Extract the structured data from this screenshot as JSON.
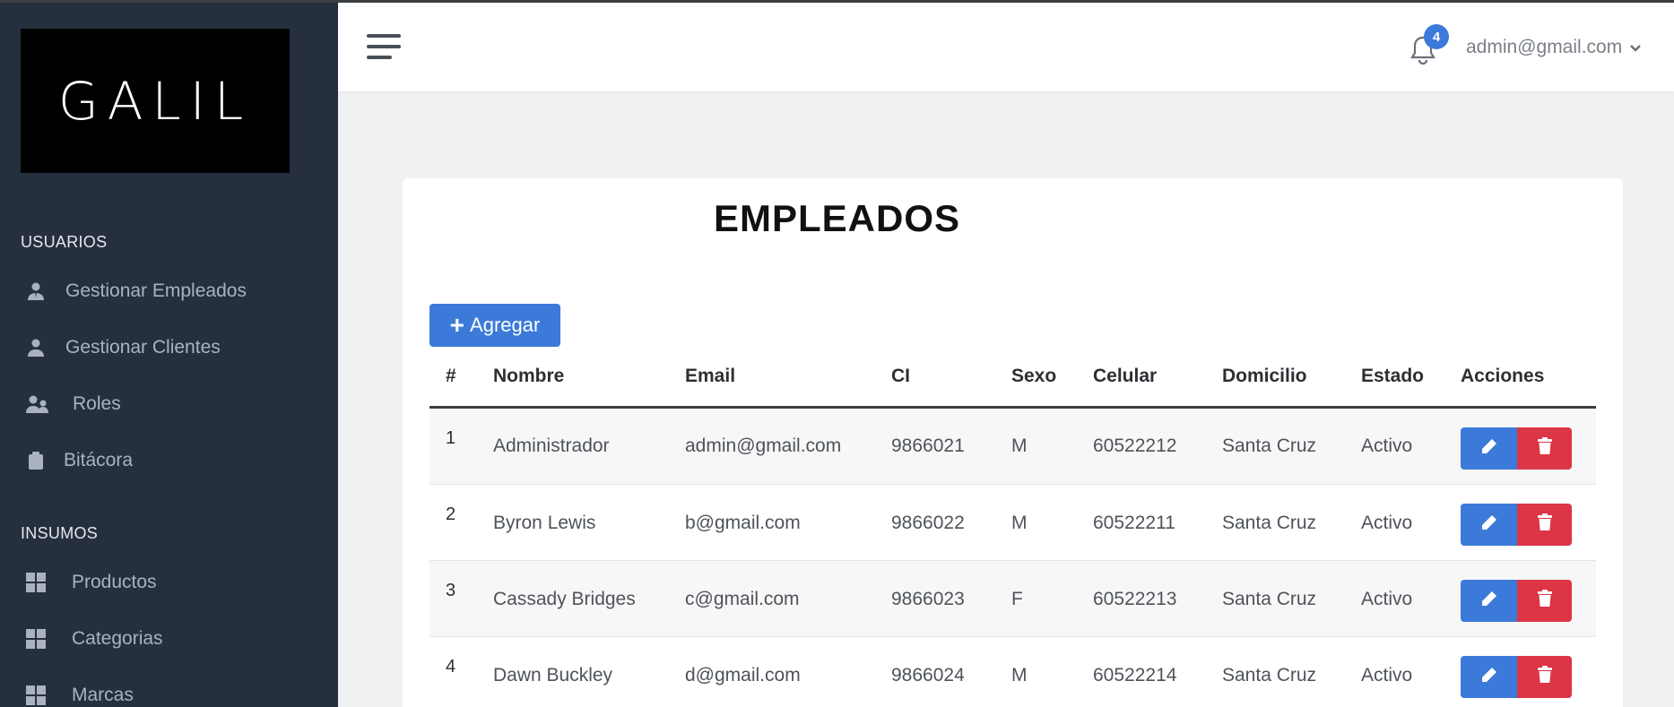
{
  "logo": {
    "text": "GALIL"
  },
  "sidebar": {
    "sections": [
      {
        "heading": "USUARIOS",
        "items": [
          {
            "label": "Gestionar Empleados",
            "icon": "user-tie-icon"
          },
          {
            "label": "Gestionar Clientes",
            "icon": "user-icon"
          },
          {
            "label": "Roles",
            "icon": "users-cog-icon"
          },
          {
            "label": "Bitácora",
            "icon": "clipboard-icon"
          }
        ]
      },
      {
        "heading": "INSUMOS",
        "items": [
          {
            "label": "Productos",
            "icon": "grid-icon"
          },
          {
            "label": "Categorias",
            "icon": "grid-icon"
          },
          {
            "label": "Marcas",
            "icon": "grid-icon"
          }
        ]
      }
    ]
  },
  "topbar": {
    "notification_count": "4",
    "user_email": "admin@gmail.com"
  },
  "page": {
    "title": "EMPLEADOS",
    "add_label": "Agregar"
  },
  "table": {
    "columns": [
      "#",
      "Nombre",
      "Email",
      "CI",
      "Sexo",
      "Celular",
      "Domicilio",
      "Estado",
      "Acciones"
    ],
    "rows": [
      [
        "1",
        "Administrador",
        "admin@gmail.com",
        "9866021",
        "M",
        "60522212",
        "Santa Cruz",
        "Activo"
      ],
      [
        "2",
        "Byron Lewis",
        "b@gmail.com",
        "9866022",
        "M",
        "60522211",
        "Santa Cruz",
        "Activo"
      ],
      [
        "3",
        "Cassady Bridges",
        "c@gmail.com",
        "9866023",
        "F",
        "60522213",
        "Santa Cruz",
        "Activo"
      ],
      [
        "4",
        "Dawn Buckley",
        "d@gmail.com",
        "9866024",
        "M",
        "60522214",
        "Santa Cruz",
        "Activo"
      ]
    ]
  },
  "colors": {
    "sidebar": "#252f3e",
    "primary": "#3c7ad9",
    "danger": "#dc3545"
  }
}
